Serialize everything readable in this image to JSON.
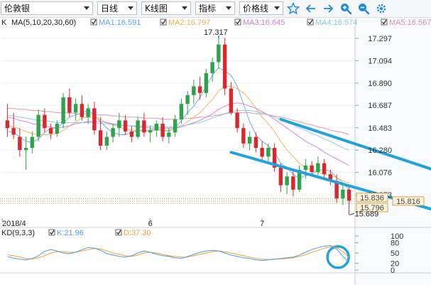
{
  "toolbar": {
    "instrument": "伦敦银",
    "period": "日线",
    "chart_type": "K线图",
    "indicator": "指标",
    "price_type": "价格线",
    "icons": [
      "star-icon",
      "arrow-left-icon",
      "arrow-right-icon",
      "zoom-in-icon",
      "zoom-out-icon",
      "settings-icon"
    ]
  },
  "ma_legend": {
    "header": "K",
    "params": "MA(5,10,20,30,60)",
    "items": [
      {
        "label": "MA1:16.591",
        "color": "#5aa7e8"
      },
      {
        "label": "MA2:16.797",
        "color": "#f0b045"
      },
      {
        "label": "MA3:16.645",
        "color": "#d27ad8"
      },
      {
        "label": "MA4:16.574",
        "color": "#7ec7e8"
      },
      {
        "label": "MA5:16.567",
        "color": "#d98db0"
      }
    ]
  },
  "kd_legend": {
    "params": "KD(9,3,3)",
    "items": [
      {
        "label": "K:21.96",
        "color": "#4a9de0"
      },
      {
        "label": "D:37.30",
        "color": "#f0a030"
      }
    ]
  },
  "chart_data": {
    "type": "candlestick",
    "y_ticks": [
      "17.297",
      "17.094",
      "16.890",
      "16.687",
      "16.483",
      "16.280",
      "16.076",
      "15.873"
    ],
    "ylim": [
      15.66,
      17.4
    ],
    "x_ticks": [
      "2018/4",
      "6",
      "7"
    ],
    "high_label": "17.317",
    "low_label": "15.689",
    "price_tags": [
      {
        "label": "15.836",
        "value": 15.836,
        "side": "left"
      },
      {
        "label": "15.816",
        "value": 15.816,
        "side": "right"
      },
      {
        "label": "15.796",
        "value": 15.796,
        "side": "left"
      }
    ],
    "ohlc": [
      [
        16.55,
        16.7,
        16.4,
        16.48
      ],
      [
        16.48,
        16.62,
        16.38,
        16.42
      ],
      [
        16.4,
        16.48,
        16.22,
        16.28
      ],
      [
        16.28,
        16.4,
        16.1,
        16.3
      ],
      [
        16.3,
        16.45,
        16.25,
        16.4
      ],
      [
        16.4,
        16.65,
        16.36,
        16.6
      ],
      [
        16.6,
        16.66,
        16.44,
        16.48
      ],
      [
        16.48,
        16.52,
        16.38,
        16.43
      ],
      [
        16.43,
        16.55,
        16.4,
        16.52
      ],
      [
        16.52,
        16.8,
        16.48,
        16.76
      ],
      [
        16.76,
        16.84,
        16.58,
        16.62
      ],
      [
        16.62,
        16.75,
        16.55,
        16.7
      ],
      [
        16.7,
        16.78,
        16.55,
        16.58
      ],
      [
        16.58,
        16.7,
        16.52,
        16.66
      ],
      [
        16.66,
        16.72,
        16.42,
        16.46
      ],
      [
        16.46,
        16.58,
        16.28,
        16.32
      ],
      [
        16.32,
        16.45,
        16.28,
        16.4
      ],
      [
        16.4,
        16.52,
        16.35,
        16.48
      ],
      [
        16.48,
        16.62,
        16.4,
        16.55
      ],
      [
        16.55,
        16.6,
        16.42,
        16.45
      ],
      [
        16.45,
        16.5,
        16.35,
        16.4
      ],
      [
        16.4,
        16.58,
        16.38,
        16.55
      ],
      [
        16.55,
        16.62,
        16.4,
        16.44
      ],
      [
        16.44,
        16.5,
        16.35,
        16.46
      ],
      [
        16.46,
        16.55,
        16.4,
        16.52
      ],
      [
        16.52,
        16.58,
        16.36,
        16.4
      ],
      [
        16.4,
        16.48,
        16.34,
        16.44
      ],
      [
        16.44,
        16.6,
        16.4,
        16.56
      ],
      [
        16.56,
        16.75,
        16.52,
        16.7
      ],
      [
        16.7,
        16.82,
        16.6,
        16.78
      ],
      [
        16.78,
        16.92,
        16.7,
        16.86
      ],
      [
        16.86,
        16.95,
        16.74,
        16.8
      ],
      [
        16.8,
        17.02,
        16.76,
        16.98
      ],
      [
        16.98,
        17.12,
        16.9,
        17.08
      ],
      [
        17.08,
        17.32,
        17.02,
        17.24
      ],
      [
        17.24,
        17.3,
        16.78,
        16.84
      ],
      [
        16.84,
        16.9,
        16.6,
        16.62
      ],
      [
        16.62,
        16.66,
        16.44,
        16.48
      ],
      [
        16.48,
        16.52,
        16.3,
        16.34
      ],
      [
        16.34,
        16.45,
        16.28,
        16.4
      ],
      [
        16.4,
        16.44,
        16.26,
        16.3
      ],
      [
        16.3,
        16.36,
        16.18,
        16.22
      ],
      [
        16.22,
        16.34,
        16.16,
        16.3
      ],
      [
        16.3,
        16.34,
        16.08,
        16.12
      ],
      [
        16.12,
        16.16,
        15.9,
        15.96
      ],
      [
        15.96,
        16.08,
        15.88,
        16.04
      ],
      [
        16.04,
        16.1,
        15.86,
        15.92
      ],
      [
        15.92,
        16.14,
        15.9,
        16.1
      ],
      [
        16.1,
        16.2,
        16.02,
        16.14
      ],
      [
        16.14,
        16.18,
        16.04,
        16.08
      ],
      [
        16.08,
        16.22,
        16.04,
        16.16
      ],
      [
        16.16,
        16.2,
        16.02,
        16.06
      ],
      [
        16.06,
        16.1,
        15.96,
        16.0
      ],
      [
        16.0,
        16.06,
        15.8,
        15.84
      ],
      [
        15.84,
        15.96,
        15.78,
        15.92
      ],
      [
        15.92,
        15.96,
        15.69,
        15.82
      ]
    ],
    "ma_lines": [
      [
        16.45,
        16.44,
        16.4,
        16.36,
        16.35,
        16.38,
        16.44,
        16.48,
        16.48,
        16.53,
        16.58,
        16.6,
        16.62,
        16.64,
        16.6,
        16.54,
        16.48,
        16.44,
        16.42,
        16.42,
        16.44,
        16.46,
        16.46,
        16.46,
        16.47,
        16.46,
        16.45,
        16.48,
        16.55,
        16.62,
        16.68,
        16.76,
        16.86,
        16.96,
        17.03,
        17.0,
        16.96,
        16.86,
        16.7,
        16.54,
        16.42,
        16.36,
        16.32,
        16.26,
        16.16,
        16.12,
        16.06,
        16.02,
        16.05,
        16.06,
        16.1,
        16.1,
        16.09,
        16.03,
        15.98,
        15.92
      ],
      [
        16.5,
        16.49,
        16.47,
        16.45,
        16.43,
        16.42,
        16.42,
        16.42,
        16.43,
        16.46,
        16.5,
        16.54,
        16.57,
        16.58,
        16.58,
        16.56,
        16.53,
        16.51,
        16.49,
        16.47,
        16.46,
        16.46,
        16.45,
        16.45,
        16.46,
        16.46,
        16.46,
        16.47,
        16.5,
        16.54,
        16.58,
        16.62,
        16.68,
        16.74,
        16.82,
        16.86,
        16.86,
        16.84,
        16.8,
        16.74,
        16.66,
        16.58,
        16.52,
        16.45,
        16.36,
        16.28,
        16.22,
        16.16,
        16.12,
        16.1,
        16.08,
        16.06,
        16.05,
        16.03,
        16.0,
        15.98
      ],
      [
        16.58,
        16.57,
        16.55,
        16.54,
        16.52,
        16.51,
        16.5,
        16.49,
        16.48,
        16.49,
        16.5,
        16.52,
        16.53,
        16.54,
        16.54,
        16.54,
        16.53,
        16.52,
        16.51,
        16.5,
        16.5,
        16.49,
        16.49,
        16.48,
        16.48,
        16.48,
        16.48,
        16.48,
        16.49,
        16.51,
        16.53,
        16.55,
        16.58,
        16.61,
        16.65,
        16.68,
        16.7,
        16.71,
        16.7,
        16.68,
        16.66,
        16.63,
        16.6,
        16.56,
        16.52,
        16.48,
        16.44,
        16.4,
        16.36,
        16.33,
        16.3,
        16.26,
        16.23,
        16.2,
        16.17,
        16.14
      ],
      [
        16.6,
        16.59,
        16.58,
        16.57,
        16.56,
        16.55,
        16.55,
        16.54,
        16.53,
        16.53,
        16.53,
        16.53,
        16.53,
        16.53,
        16.53,
        16.52,
        16.52,
        16.51,
        16.51,
        16.5,
        16.5,
        16.5,
        16.5,
        16.5,
        16.49,
        16.49,
        16.49,
        16.49,
        16.5,
        16.51,
        16.52,
        16.53,
        16.55,
        16.57,
        16.59,
        16.61,
        16.63,
        16.64,
        16.64,
        16.64,
        16.63,
        16.62,
        16.6,
        16.58,
        16.56,
        16.53,
        16.51,
        16.48,
        16.46,
        16.43,
        16.41,
        16.38,
        16.36,
        16.33,
        16.3,
        16.28
      ],
      [
        16.66,
        16.66,
        16.65,
        16.65,
        16.64,
        16.64,
        16.63,
        16.63,
        16.62,
        16.62,
        16.62,
        16.61,
        16.61,
        16.61,
        16.6,
        16.6,
        16.6,
        16.59,
        16.59,
        16.58,
        16.58,
        16.58,
        16.57,
        16.57,
        16.57,
        16.56,
        16.56,
        16.56,
        16.56,
        16.57,
        16.57,
        16.58,
        16.58,
        16.59,
        16.6,
        16.61,
        16.62,
        16.62,
        16.62,
        16.62,
        16.61,
        16.61,
        16.6,
        16.59,
        16.58,
        16.57,
        16.55,
        16.54,
        16.52,
        16.51,
        16.49,
        16.48,
        16.46,
        16.45,
        16.44,
        16.42
      ]
    ],
    "kd": {
      "y_ticks": [
        "100",
        "80",
        "50",
        "20",
        "0"
      ],
      "k": [
        40,
        35,
        32,
        30,
        34,
        42,
        55,
        60,
        56,
        50,
        48,
        52,
        60,
        66,
        64,
        58,
        48,
        44,
        40,
        38,
        42,
        50,
        56,
        52,
        46,
        42,
        40,
        36,
        34,
        40,
        46,
        52,
        56,
        58,
        56,
        50,
        44,
        40,
        36,
        34,
        30,
        28,
        30,
        32,
        34,
        36,
        38,
        44,
        52,
        60,
        66,
        70,
        72,
        62,
        40,
        22
      ],
      "d": [
        45,
        42,
        38,
        34,
        32,
        36,
        42,
        50,
        54,
        54,
        52,
        52,
        56,
        60,
        63,
        62,
        56,
        50,
        46,
        42,
        40,
        44,
        50,
        52,
        50,
        46,
        42,
        40,
        38,
        38,
        42,
        46,
        50,
        54,
        56,
        54,
        50,
        46,
        42,
        38,
        34,
        32,
        31,
        32,
        33,
        34,
        36,
        40,
        45,
        52,
        58,
        64,
        68,
        66,
        54,
        37
      ]
    },
    "annotations": {
      "upper_line": {
        "from": [
          44,
          16.56
        ],
        "to": [
          82,
          15.85
        ]
      },
      "lower_line": {
        "from": [
          36,
          16.26
        ],
        "to": [
          74,
          15.65
        ]
      },
      "circle": "kd-crossover"
    }
  }
}
